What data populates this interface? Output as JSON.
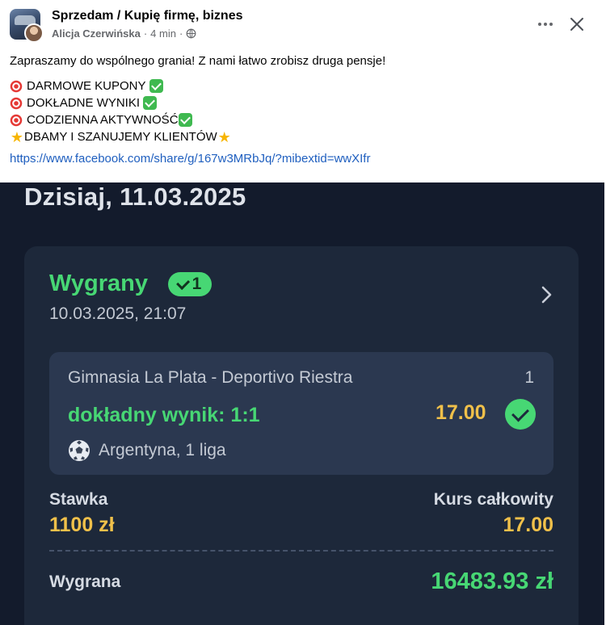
{
  "post": {
    "group_name": "Sprzedam / Kupię firmę, biznes",
    "author": "Alicja Czerwińska",
    "time": "4 min",
    "separator": "·",
    "intro": "Zapraszamy do wspólnego grania! Z nami łatwo zrobisz druga pensje!",
    "features": [
      {
        "icon": "target-icon",
        "text": "DARMOWE KUPONY ",
        "suffix_icon": "check-icon"
      },
      {
        "icon": "target-icon",
        "text": "DOKŁADNE WYNIKI ",
        "suffix_icon": "check-icon"
      },
      {
        "icon": "target-icon",
        "text": "CODZIENNA AKTYWNOŚĆ",
        "suffix_icon": "check-icon"
      },
      {
        "icon": "star-icon",
        "text": " DBAMY I SZANUJEMY KLIENTÓW",
        "suffix_icon": "star-icon"
      }
    ],
    "link": "https://www.facebook.com/share/g/167w3MRbJq/?mibextid=wwXIfr",
    "star_glyph": "★"
  },
  "bet_slip": {
    "date_title": "Dzisiaj, 11.03.2025",
    "status": "Wygrany",
    "badge_count": "1",
    "bet_time": "10.03.2025, 21:07",
    "match": {
      "name": "Gimnasia La Plata - Deportivo Riestra",
      "index": "1",
      "pick": "dokładny wynik: 1:1",
      "odds": "17.00",
      "league": "Argentyna, 1 liga"
    },
    "stake_label": "Stawka",
    "stake_value": "1100 zł",
    "total_odds_label": "Kurs całkowity",
    "total_odds_value": "17.00",
    "win_label": "Wygrana",
    "win_value": "16483.93 zł"
  },
  "colors": {
    "dark_bg": "#131b2c",
    "card_bg": "#1d283a",
    "match_bg": "#2b3850",
    "green": "#47d774",
    "gold": "#f0c04a",
    "link": "#1f5fbf"
  }
}
